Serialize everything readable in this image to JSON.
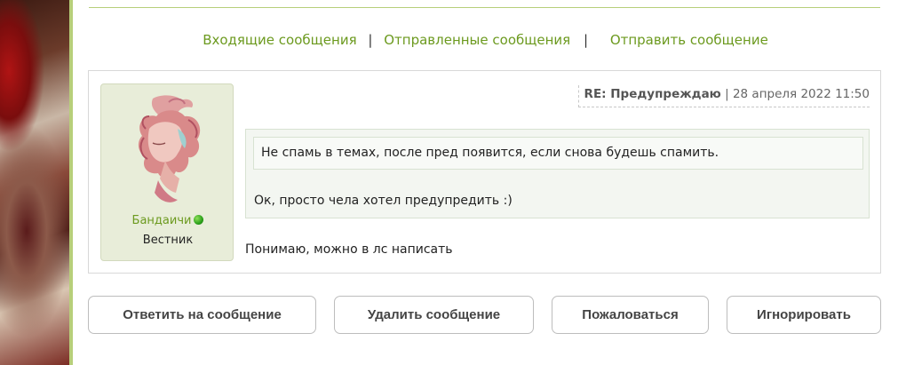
{
  "nav": {
    "inbox": "Входящие сообщения",
    "separator": "|",
    "sent": "Отправленные сообщения",
    "send": "Отправить сообщение"
  },
  "author": {
    "name": "Бандаичи",
    "rank": "Вестник",
    "online": true
  },
  "message": {
    "subject": "RE: Предупреждаю",
    "meta_separator": " | ",
    "date": "28 апреля 2022 11:50",
    "quote_text": "Не спамь в темах, после пред появится, если снова будешь спамить.",
    "quote_reply": "Ок, просто чела хотел предупредить :)",
    "body": "Понимаю, можно в лс написать"
  },
  "actions": {
    "reply": "Ответить на сообщение",
    "delete": "Удалить сообщение",
    "report": "Пожаловаться",
    "ignore": "Игнорировать"
  },
  "colors": {
    "accent_green": "#6c9a1f",
    "rule_green": "#b7cf7a",
    "card_bg": "#e8edd9"
  }
}
